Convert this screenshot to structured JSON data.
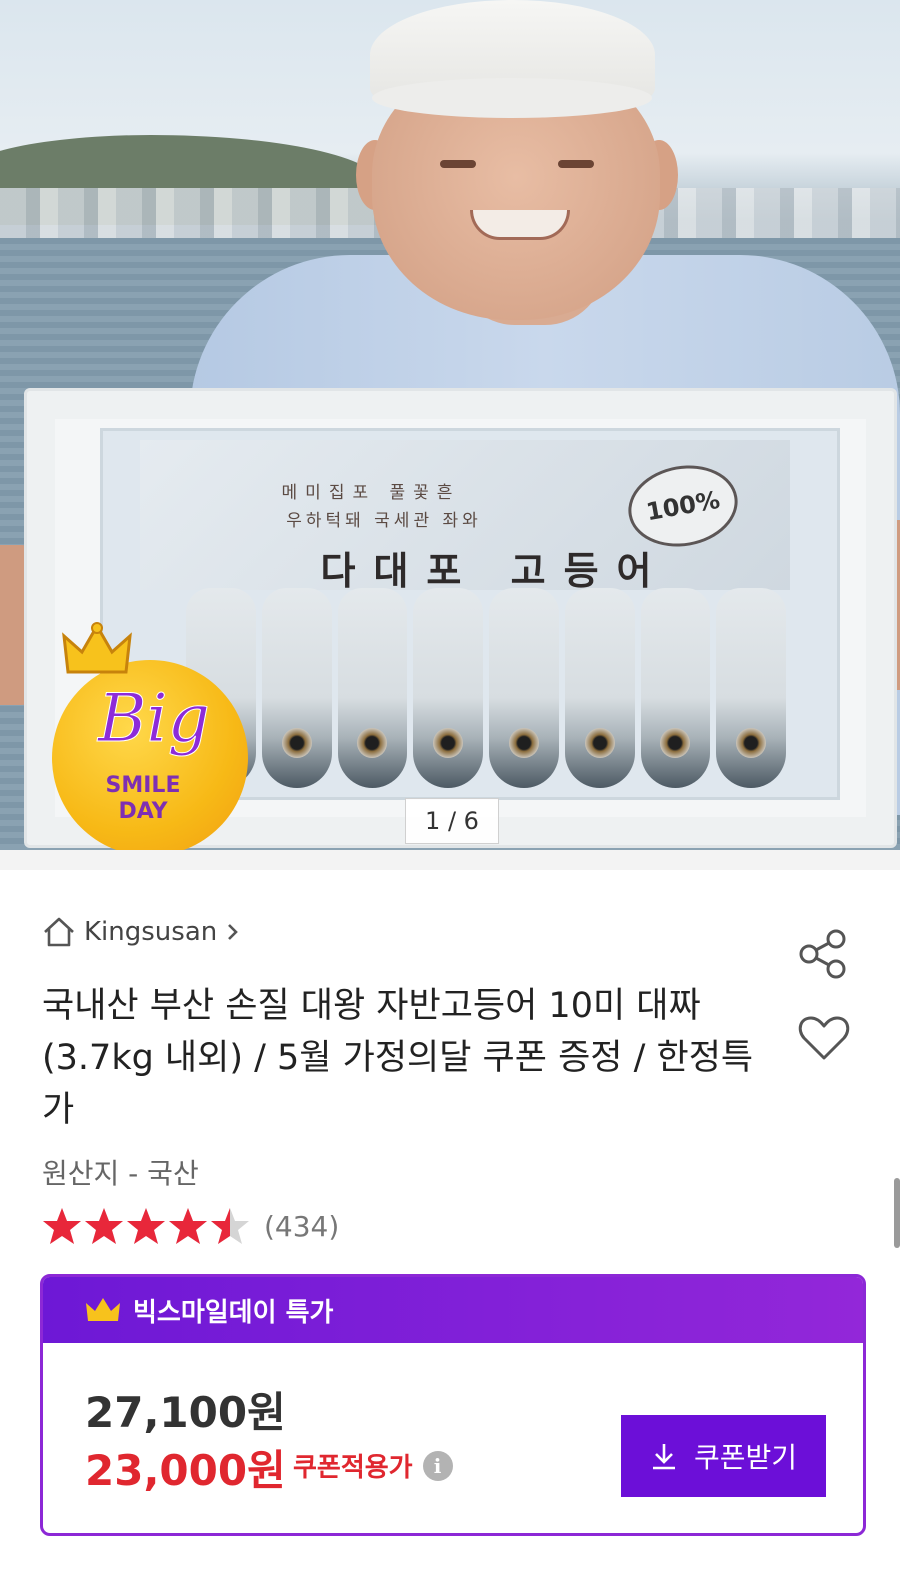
{
  "gallery": {
    "counter": "1 / 6",
    "package_line1": "메미집포 풀꽃흔",
    "package_line2": "우하턱돼 국세관 좌와",
    "package_title": "다대포 고등어",
    "seal_text": "100%",
    "badge_big": "Big",
    "badge_smile": "SMILE",
    "badge_day": "DAY"
  },
  "seller": {
    "name": "Kingsusan",
    "icon": "home-icon"
  },
  "product": {
    "title": "국내산 부산 손질 대왕 자반고등어 10미 대짜 (3.7kg 내외) / 5월 가정의달 쿠폰 증정 / 한정특가",
    "origin": "원산지 - 국산",
    "rating": 4.5,
    "review_count": "(434)"
  },
  "deal": {
    "header": "빅스마일데이 특가",
    "original_price": "27,100원",
    "sale_price": "23,000원",
    "coupon_label": "쿠폰적용가",
    "coupon_button": "쿠폰받기"
  },
  "colors": {
    "accent": "#6c0fd8",
    "sale_red": "#e0272f",
    "star": "#e8273a"
  }
}
